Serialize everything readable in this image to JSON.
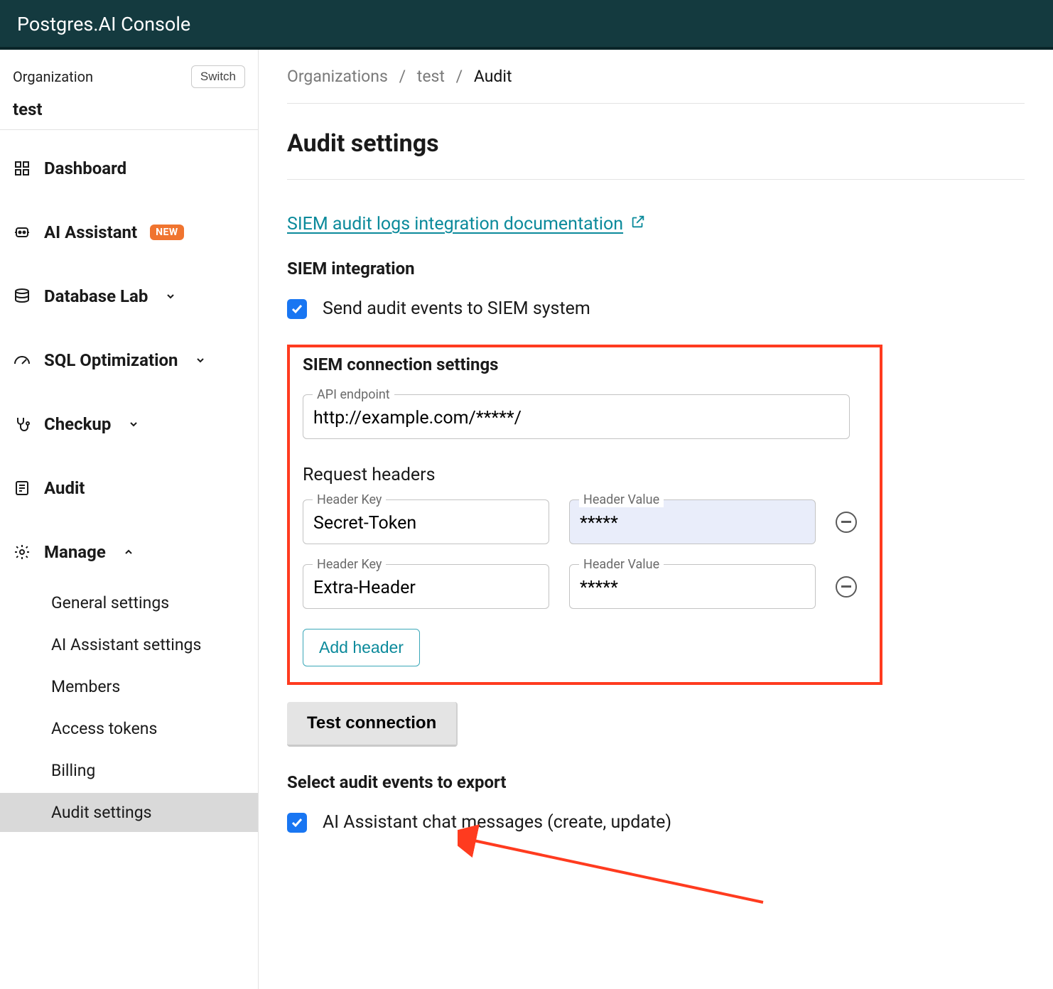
{
  "header": {
    "title": "Postgres.AI Console"
  },
  "sidebar": {
    "org_label": "Organization",
    "switch_label": "Switch",
    "org_name": "test",
    "items": [
      {
        "label": "Dashboard"
      },
      {
        "label": "AI Assistant",
        "badge": "NEW"
      },
      {
        "label": "Database Lab"
      },
      {
        "label": "SQL Optimization"
      },
      {
        "label": "Checkup"
      },
      {
        "label": "Audit"
      },
      {
        "label": "Manage"
      }
    ],
    "manage_sub": [
      {
        "label": "General settings"
      },
      {
        "label": "AI Assistant settings"
      },
      {
        "label": "Members"
      },
      {
        "label": "Access tokens"
      },
      {
        "label": "Billing"
      },
      {
        "label": "Audit settings"
      }
    ]
  },
  "breadcrumb": {
    "part0": "Organizations",
    "part1": "test",
    "part2": "Audit"
  },
  "page": {
    "title": "Audit settings",
    "doc_link": "SIEM audit logs integration documentation",
    "siem_integration_label": "SIEM integration",
    "send_events_label": "Send audit events to SIEM system",
    "conn_settings_title": "SIEM connection settings",
    "api_endpoint_label": "API endpoint",
    "api_endpoint_value": "http://example.com/*****/",
    "request_headers_label": "Request headers",
    "header_key_label": "Header Key",
    "header_value_label": "Header Value",
    "headers": [
      {
        "key": "Secret-Token",
        "value": "*****"
      },
      {
        "key": "Extra-Header",
        "value": "*****"
      }
    ],
    "add_header_label": "Add header",
    "test_connection_label": "Test connection",
    "select_events_label": "Select audit events to export",
    "event_ai_chat_label": "AI Assistant chat messages (create, update)"
  }
}
